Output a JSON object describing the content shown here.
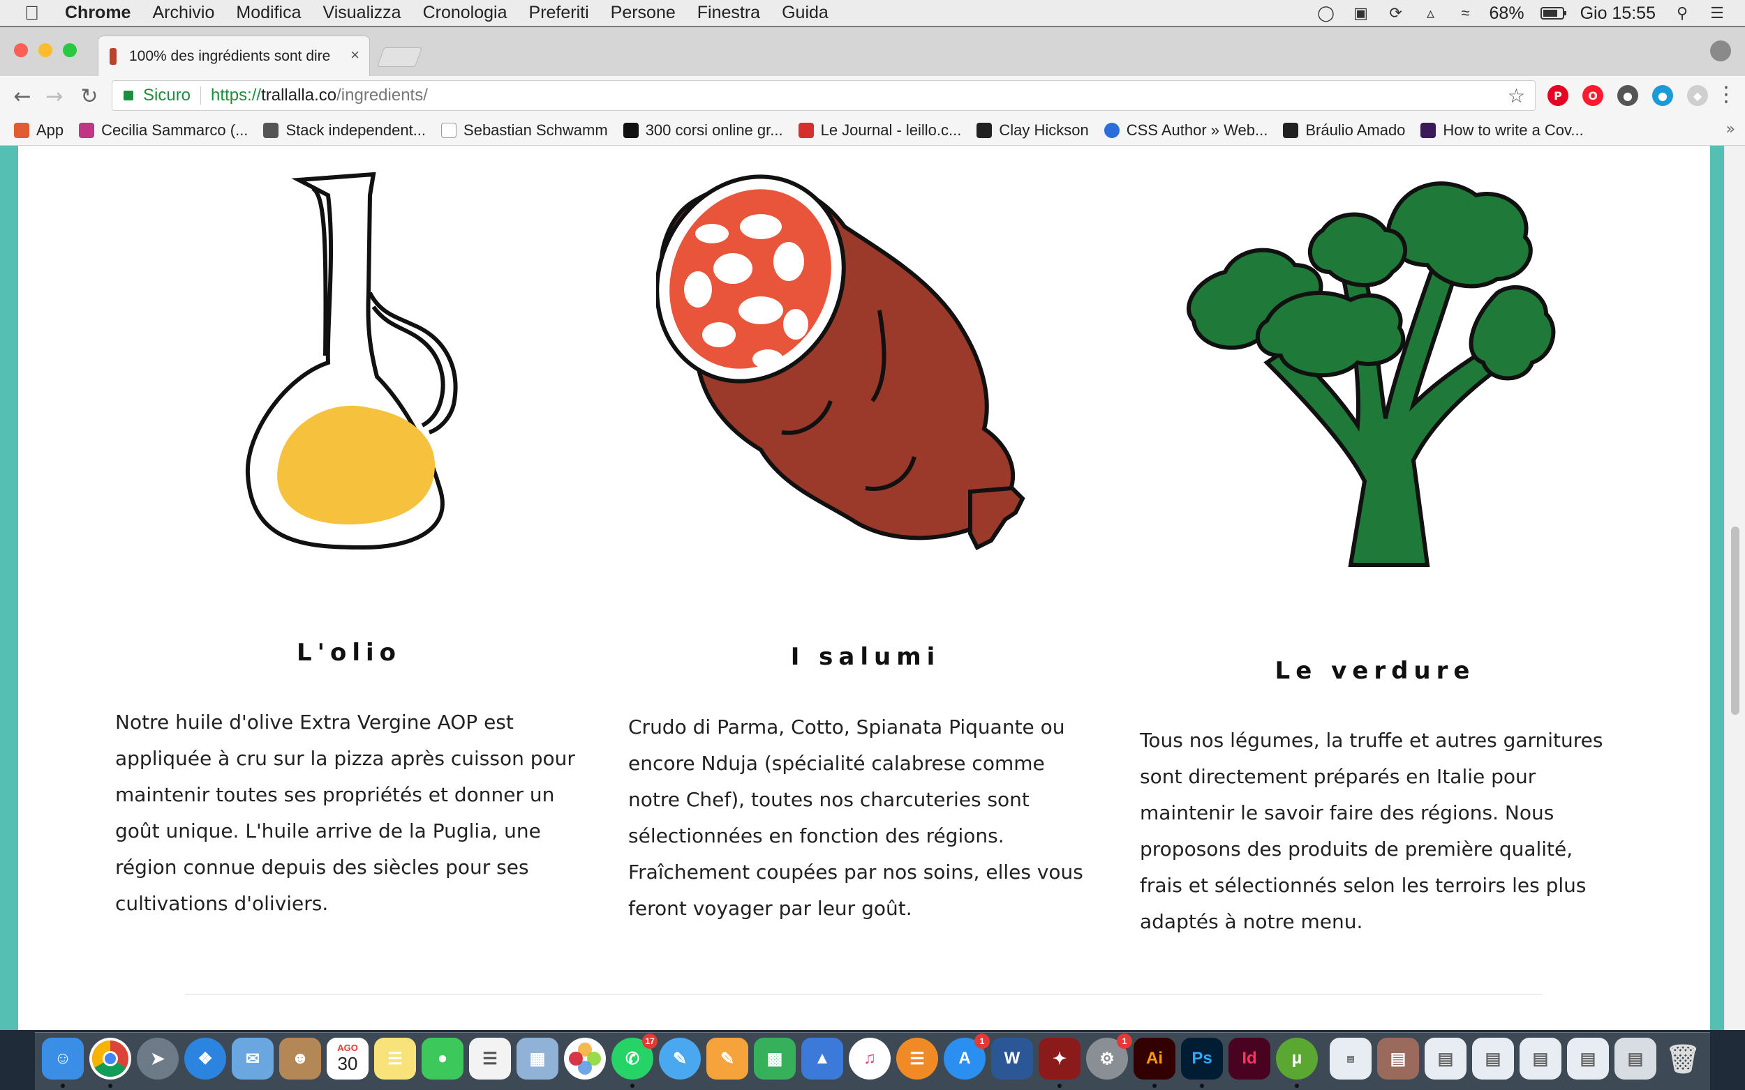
{
  "menubar": {
    "app": "Chrome",
    "items": [
      "Archivio",
      "Modifica",
      "Visualizza",
      "Cronologia",
      "Preferiti",
      "Persone",
      "Finestra",
      "Guida"
    ],
    "battery": "68%",
    "clock": "Gio 15:55"
  },
  "browser": {
    "tab_title": "100% des ingrédients sont dire",
    "secure_label": "Sicuro",
    "url_scheme": "https://",
    "url_host": "trallalla.co",
    "url_path": "/ingredients/",
    "bookmarks": [
      {
        "label": "App",
        "color": "#e25b32"
      },
      {
        "label": "Cecilia Sammarco (...",
        "color": "#c13584"
      },
      {
        "label": "Stack independent...",
        "color": "#555555"
      },
      {
        "label": "Sebastian Schwamm",
        "color": "#999999"
      },
      {
        "label": "300 corsi online gr...",
        "color": "#111111"
      },
      {
        "label": "Le Journal - leillo.c...",
        "color": "#d6302c"
      },
      {
        "label": "Clay Hickson",
        "color": "#222222"
      },
      {
        "label": "CSS Author » Web...",
        "color": "#2a6edb"
      },
      {
        "label": "Bráulio Amado",
        "color": "#222222"
      },
      {
        "label": "How to write a Cov...",
        "color": "#3a1a5a"
      }
    ]
  },
  "content": {
    "columns": [
      {
        "heading": "L'olio",
        "text": "Notre huile d'olive Extra Vergine AOP est appliquée à cru sur la pizza après cuisson pour maintenir toutes ses propriétés et donner un goût unique. L'huile arrive de la Puglia, une région connue depuis des siècles pour ses cultivations d'oliviers."
      },
      {
        "heading": "I salumi",
        "text": "Crudo di Parma, Cotto, Spianata Piquante ou encore Nduja (spécialité calabrese comme notre Chef), toutes nos charcuteries sont sélectionnées en fonction des régions. Fraîchement coupées par nos soins, elles vous feront voyager par leur goût."
      },
      {
        "heading": "Le verdure",
        "text": "Tous nos légumes, la truffe et autres garnitures sont directement préparés en Italie pour maintenir le savoir faire des régions. Nous proposons des produits de première qualité, frais et sélectionnés selon les terroirs les plus adaptés à notre menu."
      }
    ],
    "colors": {
      "page_bg": "#56bfb4",
      "oil": "#f6c13c",
      "salami": "#9b3a2a",
      "salami_cut": "#e8553a",
      "tree": "#1f7a3a"
    }
  },
  "dock": {
    "calendar_month": "AGO",
    "calendar_day": "30",
    "whatsapp_badge": "17",
    "appstore_badge": "1",
    "prefs_badge": "1",
    "ai_label": "Ai",
    "ps_label": "Ps",
    "id_label": "Id",
    "word_label": "W"
  }
}
